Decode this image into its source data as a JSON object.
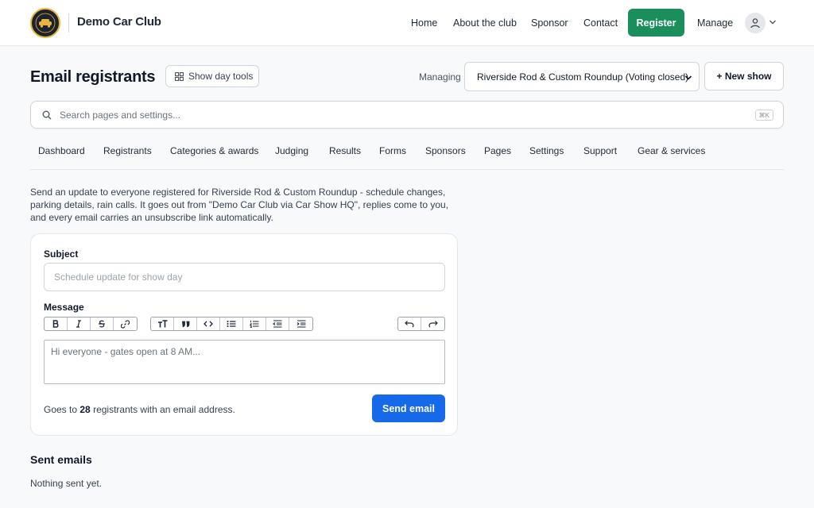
{
  "header": {
    "brand": "Demo Car Club",
    "nav": [
      {
        "label": "Home"
      },
      {
        "label": "About the club"
      },
      {
        "label": "Sponsor"
      },
      {
        "label": "Contact"
      }
    ],
    "register_label": "Register",
    "manage_label": "Manage",
    "icons": {
      "logo": "car-club-logo",
      "avatar": "user-icon",
      "menu": "chevron-down-icon"
    }
  },
  "page": {
    "title": "Email registrants",
    "day_tools_label": "Show day tools",
    "managing_label": "Managing",
    "selected_show": "Riverside Rod & Custom Roundup (Voting closed)",
    "new_show_label": "+ New show"
  },
  "search": {
    "placeholder": "Search pages and settings...",
    "shortcut": "⌘K"
  },
  "tabs": [
    {
      "label": "Dashboard"
    },
    {
      "label": "Registrants"
    },
    {
      "label": "Categories & awards"
    },
    {
      "label": "Judging"
    },
    {
      "label": "Results"
    },
    {
      "label": "Forms"
    },
    {
      "label": "Sponsors"
    },
    {
      "label": "Pages"
    },
    {
      "label": "Settings"
    },
    {
      "label": "Support"
    },
    {
      "label": "Gear & services"
    }
  ],
  "intro": "Send an update to everyone registered for Riverside Rod & Custom Roundup - schedule changes, parking details, rain calls. It goes out from \"Demo Car Club via Car Show HQ\", replies come to you, and every email carries an unsubscribe link automatically.",
  "form": {
    "subject_label": "Subject",
    "subject_value": "",
    "subject_placeholder": "Schedule update for show day",
    "message_label": "Message",
    "message_value": "",
    "message_placeholder": "Hi everyone - gates open at 8 AM...",
    "toolbar": [
      "bold",
      "italic",
      "strikethrough",
      "link",
      "heading",
      "quote",
      "code",
      "bullet-list",
      "numbered-list",
      "outdent",
      "indent",
      "undo",
      "redo"
    ],
    "goes_to_prefix": "Goes to",
    "recipient_count": "28",
    "goes_to_suffix": "registrants with an email address.",
    "send_label": "Send email"
  },
  "sent": {
    "title": "Sent emails",
    "empty": "Nothing sent yet."
  },
  "colors": {
    "register": "#1a8f5c",
    "send": "#1669e8"
  }
}
